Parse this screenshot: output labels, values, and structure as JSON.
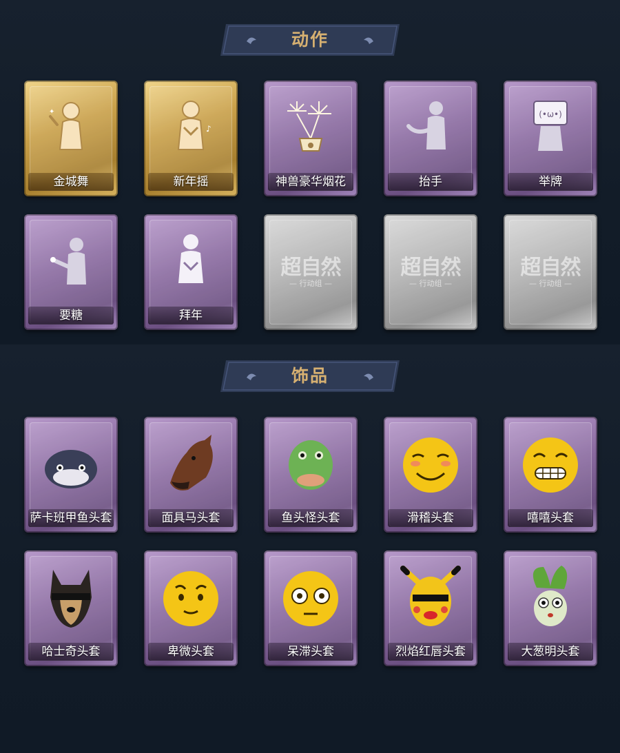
{
  "sections": [
    {
      "title": "动作",
      "items": [
        {
          "label": "金城舞",
          "rarity": "gold",
          "icon": "dance-figure-icon"
        },
        {
          "label": "新年摇",
          "rarity": "gold",
          "icon": "new-year-wave-figure-icon"
        },
        {
          "label": "神兽豪华烟花",
          "rarity": "purple",
          "icon": "fireworks-icon"
        },
        {
          "label": "抬手",
          "rarity": "purple",
          "icon": "raise-hand-figure-icon"
        },
        {
          "label": "举牌",
          "rarity": "purple",
          "icon": "hold-sign-figure-icon"
        },
        {
          "label": "要糖",
          "rarity": "purple",
          "icon": "ask-candy-figure-icon"
        },
        {
          "label": "拜年",
          "rarity": "purple",
          "icon": "new-year-greeting-figure-icon"
        },
        {
          "label": "",
          "rarity": "gray",
          "icon": "locked-placeholder-icon",
          "watermark": "超自然",
          "watermark_sub": "— 行动组 —"
        },
        {
          "label": "",
          "rarity": "gray",
          "icon": "locked-placeholder-icon",
          "watermark": "超自然",
          "watermark_sub": "— 行动组 —"
        },
        {
          "label": "",
          "rarity": "gray",
          "icon": "locked-placeholder-icon",
          "watermark": "超自然",
          "watermark_sub": "— 行动组 —"
        }
      ]
    },
    {
      "title": "饰品",
      "items": [
        {
          "label": "萨卡班甲鱼头套",
          "rarity": "purple",
          "icon": "fish-head-mask-icon"
        },
        {
          "label": "面具马头套",
          "rarity": "purple",
          "icon": "horse-head-mask-icon"
        },
        {
          "label": "鱼头怪头套",
          "rarity": "purple",
          "icon": "fish-monster-mask-icon"
        },
        {
          "label": "滑稽头套",
          "rarity": "purple",
          "icon": "funny-face-mask-icon"
        },
        {
          "label": "嘻嘻头套",
          "rarity": "purple",
          "icon": "grin-face-mask-icon"
        },
        {
          "label": "哈士奇头套",
          "rarity": "purple",
          "icon": "husky-mask-icon"
        },
        {
          "label": "卑微头套",
          "rarity": "purple",
          "icon": "humble-face-mask-icon"
        },
        {
          "label": "呆滞头套",
          "rarity": "purple",
          "icon": "dazed-face-mask-icon"
        },
        {
          "label": "烈焰红唇头套",
          "rarity": "purple",
          "icon": "red-lips-mask-icon"
        },
        {
          "label": "大葱明头套",
          "rarity": "purple",
          "icon": "scallion-mask-icon"
        }
      ]
    }
  ]
}
